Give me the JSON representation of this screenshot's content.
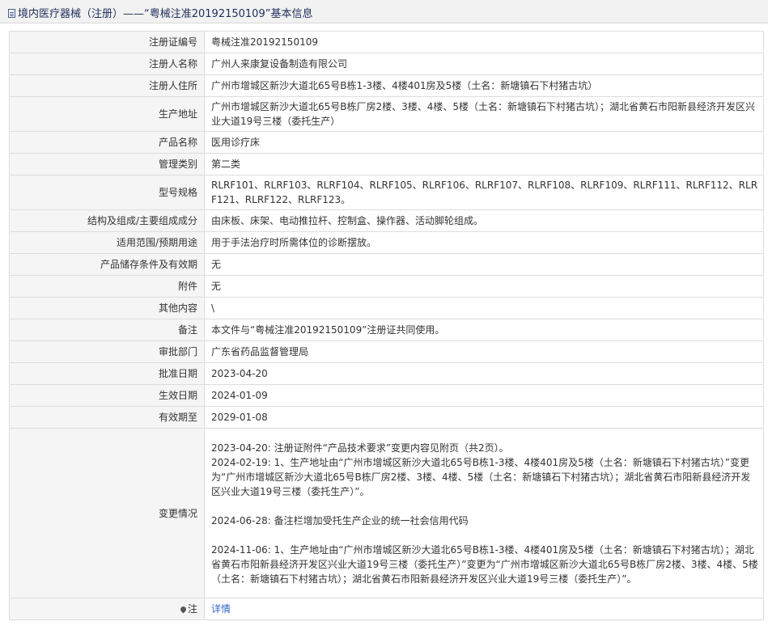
{
  "header": {
    "icon": "document-icon",
    "title": "境内医疗器械（注册）——“粤械注准20192150109”基本信息"
  },
  "rows": [
    {
      "label": "注册证编号",
      "value": "粤械注准20192150109"
    },
    {
      "label": "注册人名称",
      "value": "广州人来康复设备制造有限公司"
    },
    {
      "label": "注册人住所",
      "value": "广州市增城区新沙大道北65号B栋1-3楼、4楼401房及5楼（土名：新塘镇石下村猪古坑）"
    },
    {
      "label": "生产地址",
      "value": "广州市增城区新沙大道北65号B栋厂房2楼、3楼、4楼、5楼（土名：新塘镇石下村猪古坑）；湖北省黄石市阳新县经济开发区兴业大道19号三楼（委托生产）"
    },
    {
      "label": "产品名称",
      "value": "医用诊疗床"
    },
    {
      "label": "管理类别",
      "value": "第二类"
    },
    {
      "label": "型号规格",
      "value": "RLRF101、RLRF103、RLRF104、RLRF105、RLRF106、RLRF107、RLRF108、RLRF109、RLRF111、RLRF112、RLRF121、RLRF122、RLRF123。"
    },
    {
      "label": "结构及组成/主要组成成分",
      "value": "由床板、床架、电动推拉杆、控制盒、操作器、活动脚轮组成。"
    },
    {
      "label": "适用范围/预期用途",
      "value": "用于手法治疗时所需体位的诊断摆放。"
    },
    {
      "label": "产品储存条件及有效期",
      "value": "无"
    },
    {
      "label": "附件",
      "value": "无"
    },
    {
      "label": "其他内容",
      "value": "\\"
    },
    {
      "label": "备注",
      "value": "本文件与“粤械注准20192150109”注册证共同使用。"
    },
    {
      "label": "审批部门",
      "value": "广东省药品监督管理局"
    },
    {
      "label": "批准日期",
      "value": "2023-04-20"
    },
    {
      "label": "生效日期",
      "value": "2024-01-09"
    },
    {
      "label": "有效期至",
      "value": "2029-01-08"
    }
  ],
  "changes": {
    "label": "变更情况",
    "entries": [
      "2023-04-20: 注册证附件“产品技术要求”变更内容见附页（共2页）。",
      "2024-02-19: 1、生产地址由“广州市增城区新沙大道北65号B栋1-3楼、4楼401房及5楼（土名：新塘镇石下村猪古坑）”变更为“广州市增城区新沙大道北65号B栋厂房2楼、3楼、4楼、5楼（土名：新塘镇石下村猪古坑）；湖北省黄石市阳新县经济开发区兴业大道19号三楼（委托生产）”。",
      "",
      "2024-06-28: 备注栏增加受托生产企业的统一社会信用代码",
      "",
      "2024-11-06: 1、生产地址由“广州市增城区新沙大道北65号B栋1-3楼、4楼401房及5楼（土名：新塘镇石下村猪古坑）；湖北省黄石市阳新县经济开发区兴业大道19号三楼（委托生产）”变更为“广州市增城区新沙大道北65号B栋厂房2楼、3楼、4楼、5楼（土名：新塘镇石下村猪古坑）；湖北省黄石市阳新县经济开发区兴业大道19号三楼（委托生产）”。"
    ]
  },
  "note": {
    "icon": "pin-icon",
    "label": "注",
    "link": "详情"
  }
}
